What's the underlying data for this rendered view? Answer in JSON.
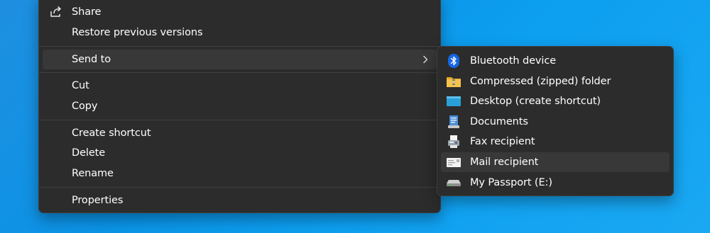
{
  "context_menu": {
    "items": [
      {
        "label": "Share",
        "icon": "share-icon"
      },
      {
        "label": "Restore previous versions"
      },
      {
        "label": "Send to",
        "has_submenu": true
      },
      {
        "label": "Cut"
      },
      {
        "label": "Copy"
      },
      {
        "label": "Create shortcut"
      },
      {
        "label": "Delete"
      },
      {
        "label": "Rename"
      },
      {
        "label": "Properties"
      }
    ]
  },
  "send_to_menu": {
    "items": [
      {
        "label": "Bluetooth device",
        "icon": "bluetooth-icon"
      },
      {
        "label": "Compressed (zipped) folder",
        "icon": "zip-folder-icon"
      },
      {
        "label": "Desktop (create shortcut)",
        "icon": "desktop-icon"
      },
      {
        "label": "Documents",
        "icon": "documents-icon"
      },
      {
        "label": "Fax recipient",
        "icon": "fax-icon"
      },
      {
        "label": "Mail recipient",
        "icon": "mail-icon"
      },
      {
        "label": "My Passport (E:)",
        "icon": "drive-icon"
      }
    ]
  },
  "colors": {
    "menu_bg": "#2c2c2c",
    "hover_bg": "#383838",
    "desktop_bg": "#0a93e6",
    "text": "#ffffff"
  }
}
